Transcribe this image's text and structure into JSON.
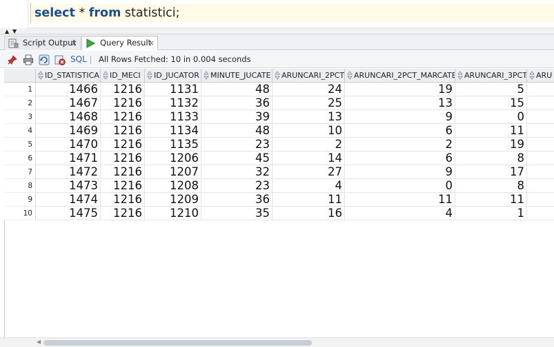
{
  "editor": {
    "kw_select": "select",
    "star": " * ",
    "kw_from": "from",
    "table_part": " statistici;"
  },
  "tabs": [
    {
      "label": "Script Output",
      "close": "×",
      "active": false,
      "icon": "script-output-icon"
    },
    {
      "label": "Query Result",
      "close": "×",
      "active": true,
      "icon": "play-icon"
    }
  ],
  "toolbar": {
    "icons": [
      "pin-icon",
      "print-icon",
      "refresh-icon",
      "cancel-query-icon"
    ],
    "sql_label": "SQL",
    "status": "All Rows Fetched: 10 in 0.004 seconds"
  },
  "grid": {
    "columns": [
      "ID_STATISTICA",
      "ID_MECI",
      "ID_JUCATOR",
      "MINUTE_JUCATE",
      "ARUNCARI_2PCT",
      "ARUNCARI_2PCT_MARCATE",
      "ARUNCARI_3PCT",
      "ARU"
    ],
    "rows": [
      {
        "n": "1",
        "cells": [
          "1466",
          "1216",
          "1131",
          "48",
          "24",
          "19",
          "5",
          ""
        ]
      },
      {
        "n": "2",
        "cells": [
          "1467",
          "1216",
          "1132",
          "36",
          "25",
          "13",
          "15",
          ""
        ]
      },
      {
        "n": "3",
        "cells": [
          "1468",
          "1216",
          "1133",
          "39",
          "13",
          "9",
          "0",
          ""
        ]
      },
      {
        "n": "4",
        "cells": [
          "1469",
          "1216",
          "1134",
          "48",
          "10",
          "6",
          "11",
          ""
        ]
      },
      {
        "n": "5",
        "cells": [
          "1470",
          "1216",
          "1135",
          "23",
          "2",
          "2",
          "19",
          ""
        ]
      },
      {
        "n": "6",
        "cells": [
          "1471",
          "1216",
          "1206",
          "45",
          "14",
          "6",
          "8",
          ""
        ]
      },
      {
        "n": "7",
        "cells": [
          "1472",
          "1216",
          "1207",
          "32",
          "27",
          "9",
          "17",
          ""
        ]
      },
      {
        "n": "8",
        "cells": [
          "1473",
          "1216",
          "1208",
          "23",
          "4",
          "0",
          "8",
          ""
        ]
      },
      {
        "n": "9",
        "cells": [
          "1474",
          "1216",
          "1209",
          "36",
          "11",
          "11",
          "11",
          ""
        ]
      },
      {
        "n": "10",
        "cells": [
          "1475",
          "1216",
          "1210",
          "35",
          "16",
          "4",
          "1",
          ""
        ]
      }
    ]
  },
  "colors": {
    "keyword": "#1b4f93",
    "active_line": "#fffbe6",
    "header_bg": "#eceef1",
    "sql_link": "#2a5fa8"
  }
}
